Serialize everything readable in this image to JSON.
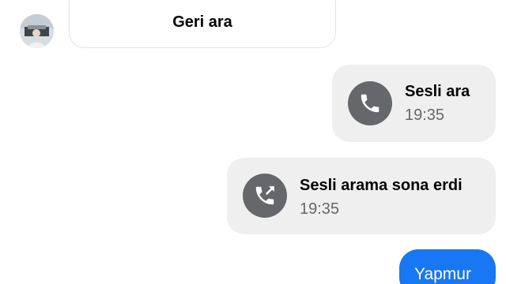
{
  "thread": {
    "callback_button": {
      "label": "Geri ara"
    },
    "messages": [
      {
        "type": "call",
        "direction": "outgoing",
        "icon": "phone-icon",
        "title": "Sesli ara",
        "time": "19:35"
      },
      {
        "type": "call",
        "direction": "ended",
        "icon": "phone-outgoing-icon",
        "title": "Sesli arama sona erdi",
        "time": "19:35"
      },
      {
        "type": "text",
        "direction": "sent",
        "text": "Yapmur"
      }
    ]
  },
  "colors": {
    "bubble_gray": "#efefef",
    "icon_gray": "#65676b",
    "sent_blue": "#1877f2",
    "text_dark": "#050505"
  }
}
